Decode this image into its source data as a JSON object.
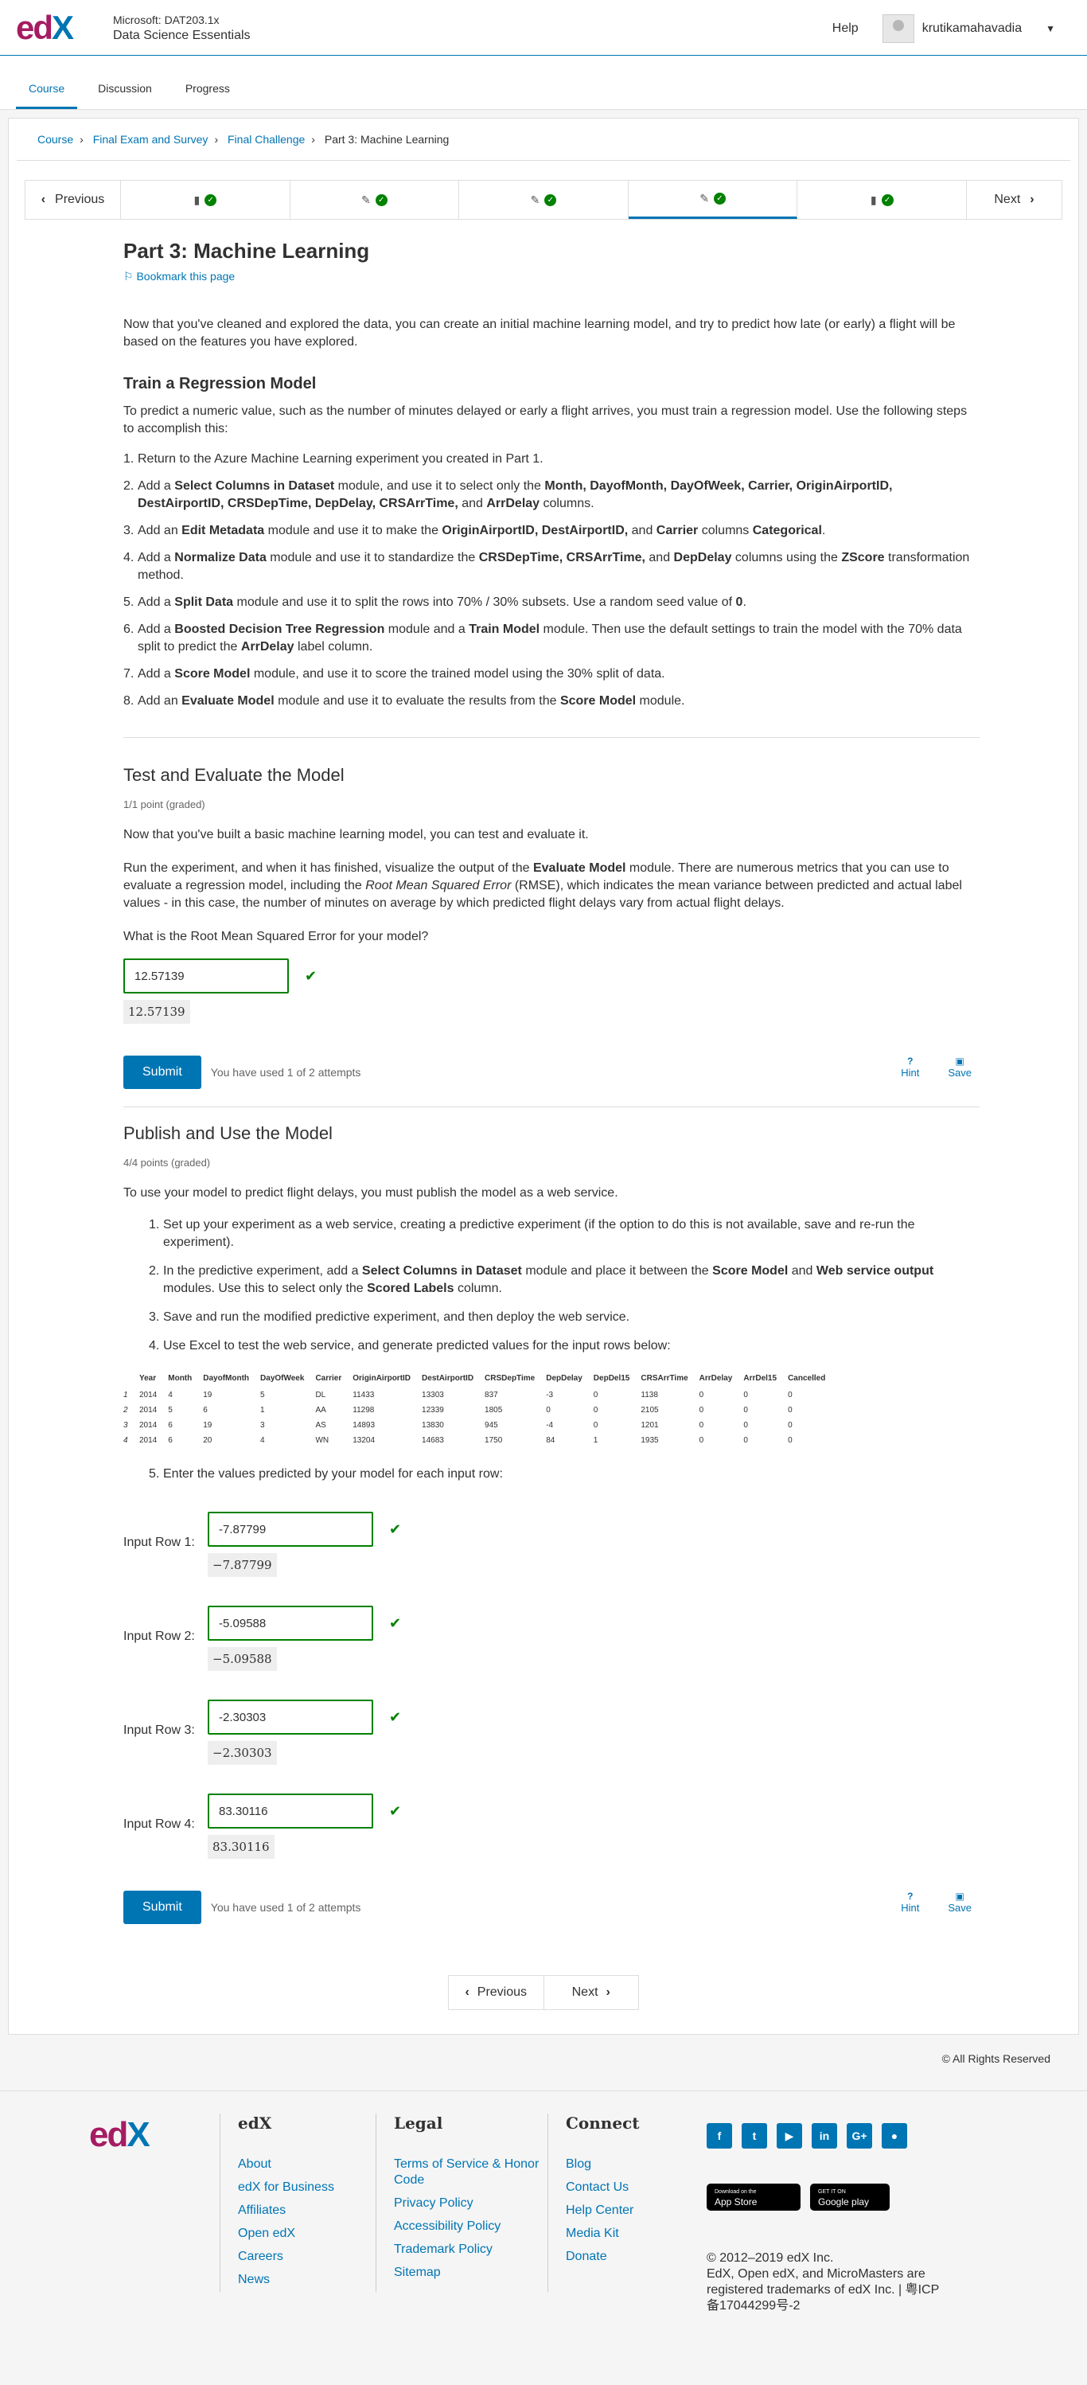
{
  "header": {
    "course_org": "Microsoft: DAT203.1x",
    "course_name": "Data Science Essentials",
    "help": "Help",
    "username": "krutikamahavadia"
  },
  "tabs": [
    "Course",
    "Discussion",
    "Progress"
  ],
  "breadcrumb": {
    "items": [
      "Course",
      "Final Exam and Survey",
      "Final Challenge"
    ],
    "current": "Part 3: Machine Learning"
  },
  "seq": {
    "previous": "Previous",
    "next": "Next"
  },
  "unit": {
    "title": "Part 3: Machine Learning",
    "bookmark": "Bookmark this page",
    "intro": "Now that you've cleaned and explored the data, you can create an initial machine learning model, and try to predict how late (or early) a flight will be based on the features you have explored."
  },
  "train": {
    "heading": "Train a Regression Model",
    "intro": "To predict a numeric value, such as the number of minutes delayed or early a flight arrives, you must train a regression model. Use the following steps to accomplish this:",
    "step1": "Return to the Azure Machine Learning experiment you created in Part 1.",
    "step2a": "Add a ",
    "step2b": "Select Columns in Dataset",
    "step2c": " module, and use it to select only the ",
    "step2d": "Month, DayofMonth, DayOfWeek, Carrier, OriginAirportID, DestAirportID, CRSDepTime, DepDelay, CRSArrTime,",
    "step2e": " and ",
    "step2f": "ArrDelay",
    "step2g": " columns.",
    "step3a": "Add an ",
    "step3b": "Edit Metadata",
    "step3c": " module and use it to make the ",
    "step3d": "OriginAirportID, DestAirportID,",
    "step3e": " and ",
    "step3f": "Carrier",
    "step3g": " columns ",
    "step3h": "Categorical",
    "step3i": ".",
    "step4a": "Add a ",
    "step4b": "Normalize Data",
    "step4c": " module and use it to standardize the ",
    "step4d": "CRSDepTime, CRSArrTime,",
    "step4e": " and ",
    "step4f": "DepDelay",
    "step4g": " columns using the ",
    "step4h": "ZScore",
    "step4i": " transformation method.",
    "step5a": "Add a ",
    "step5b": "Split Data",
    "step5c": " module and use it to split the rows into 70% / 30% subsets. Use a random seed value of ",
    "step5d": "0",
    "step5e": ".",
    "step6a": "Add a ",
    "step6b": "Boosted Decision Tree Regression",
    "step6c": " module and a ",
    "step6d": "Train Model",
    "step6e": " module. Then use the default settings to train the model with the 70% data split to predict the ",
    "step6f": "ArrDelay",
    "step6g": " label column.",
    "step7a": "Add a ",
    "step7b": "Score Model",
    "step7c": " module, and use it to score the trained model using the 30% split of data.",
    "step8a": "Add an ",
    "step8b": "Evaluate Model",
    "step8c": " module and use it to evaluate the results from the ",
    "step8d": "Score Model",
    "step8e": " module."
  },
  "test": {
    "heading": "Test and Evaluate the Model",
    "graded": "1/1 point (graded)",
    "p1": "Now that you've built a basic machine learning model, you can test and evaluate it.",
    "p2a": "Run the experiment, and when it has finished, visualize the output of the ",
    "p2b": "Evaluate Model",
    "p2c": " module. There are numerous metrics that you can use to evaluate a regression model, including the ",
    "p2d": "Root Mean Squared Error",
    "p2e": " (RMSE), which indicates the mean variance between predicted and actual label values - in this case, the number of minutes on average by which predicted flight delays vary from actual flight delays.",
    "question": "What is the Root Mean Squared Error for your model?",
    "answer": "12.57139",
    "echo": "12.57139",
    "submit": "Submit",
    "attempts": "You have used 1 of 2 attempts",
    "hint": "Hint",
    "save": "Save"
  },
  "publish": {
    "heading": "Publish and Use the Model",
    "graded": "4/4 points (graded)",
    "intro": "To use your model to predict flight delays, you must publish the model as a web service.",
    "s1": "Set up your experiment as a web service, creating a predictive experiment (if the option to do this is not available, save and re-run the experiment).",
    "s2a": "In the predictive experiment, add a ",
    "s2b": "Select Columns in Dataset",
    "s2c": " module and place it between the ",
    "s2d": "Score Model",
    "s2e": " and ",
    "s2f": "Web service output",
    "s2g": " modules. Use this to select only the ",
    "s2h": "Scored Labels",
    "s2i": " column.",
    "s3": "Save and run the modified predictive experiment, and then deploy the web service.",
    "s4": "Use Excel to test the web service, and generate predicted values for the input rows below:",
    "s5": "Enter the values predicted by your model for each input row:",
    "columns": [
      "Year",
      "Month",
      "DayofMonth",
      "DayOfWeek",
      "Carrier",
      "OriginAirportID",
      "DestAirportID",
      "CRSDepTime",
      "DepDelay",
      "DepDel15",
      "CRSArrTime",
      "ArrDelay",
      "ArrDel15",
      "Cancelled"
    ],
    "rows": [
      [
        "1",
        "2014",
        "4",
        "19",
        "5",
        "DL",
        "11433",
        "13303",
        "837",
        "-3",
        "0",
        "1138",
        "0",
        "0",
        "0"
      ],
      [
        "2",
        "2014",
        "5",
        "6",
        "1",
        "AA",
        "11298",
        "12339",
        "1805",
        "0",
        "0",
        "2105",
        "0",
        "0",
        "0"
      ],
      [
        "3",
        "2014",
        "6",
        "19",
        "3",
        "AS",
        "14893",
        "13830",
        "945",
        "-4",
        "0",
        "1201",
        "0",
        "0",
        "0"
      ],
      [
        "4",
        "2014",
        "6",
        "20",
        "4",
        "WN",
        "13204",
        "14683",
        "1750",
        "84",
        "1",
        "1935",
        "0",
        "0",
        "0"
      ]
    ],
    "inputs": [
      {
        "label": "Input Row 1:",
        "value": "-7.87799",
        "echo": "−7.87799"
      },
      {
        "label": "Input Row 2:",
        "value": "-5.09588",
        "echo": "−5.09588"
      },
      {
        "label": "Input Row 3:",
        "value": "-2.30303",
        "echo": "−2.30303"
      },
      {
        "label": "Input Row 4:",
        "value": "83.30116",
        "echo": "83.30116"
      }
    ],
    "submit": "Submit",
    "attempts": "You have used 1 of 2 attempts",
    "hint": "Hint",
    "save": "Save"
  },
  "bottom_nav": {
    "previous": "Previous",
    "next": "Next"
  },
  "copyright": "© All Rights Reserved",
  "footer": {
    "edx_heading": "edX",
    "edx_links": [
      "About",
      "edX for Business",
      "Affiliates",
      "Open edX",
      "Careers",
      "News"
    ],
    "legal_heading": "Legal",
    "legal_links": [
      "Terms of Service & Honor Code",
      "Privacy Policy",
      "Accessibility Policy",
      "Trademark Policy",
      "Sitemap"
    ],
    "connect_heading": "Connect",
    "connect_links": [
      "Blog",
      "Contact Us",
      "Help Center",
      "Media Kit",
      "Donate"
    ],
    "app_store_small": "Download on the",
    "app_store": "App Store",
    "google_play_small": "GET IT ON",
    "google_play": "Google play",
    "legal_text": "© 2012–2019 edX Inc.\nEdX, Open edX, and MicroMasters are registered trademarks of edX Inc. | 粤ICP备17044299号-2"
  },
  "colors": {
    "accent": "#0075b4",
    "success": "#008100",
    "brand_magenta": "#a51c62"
  }
}
